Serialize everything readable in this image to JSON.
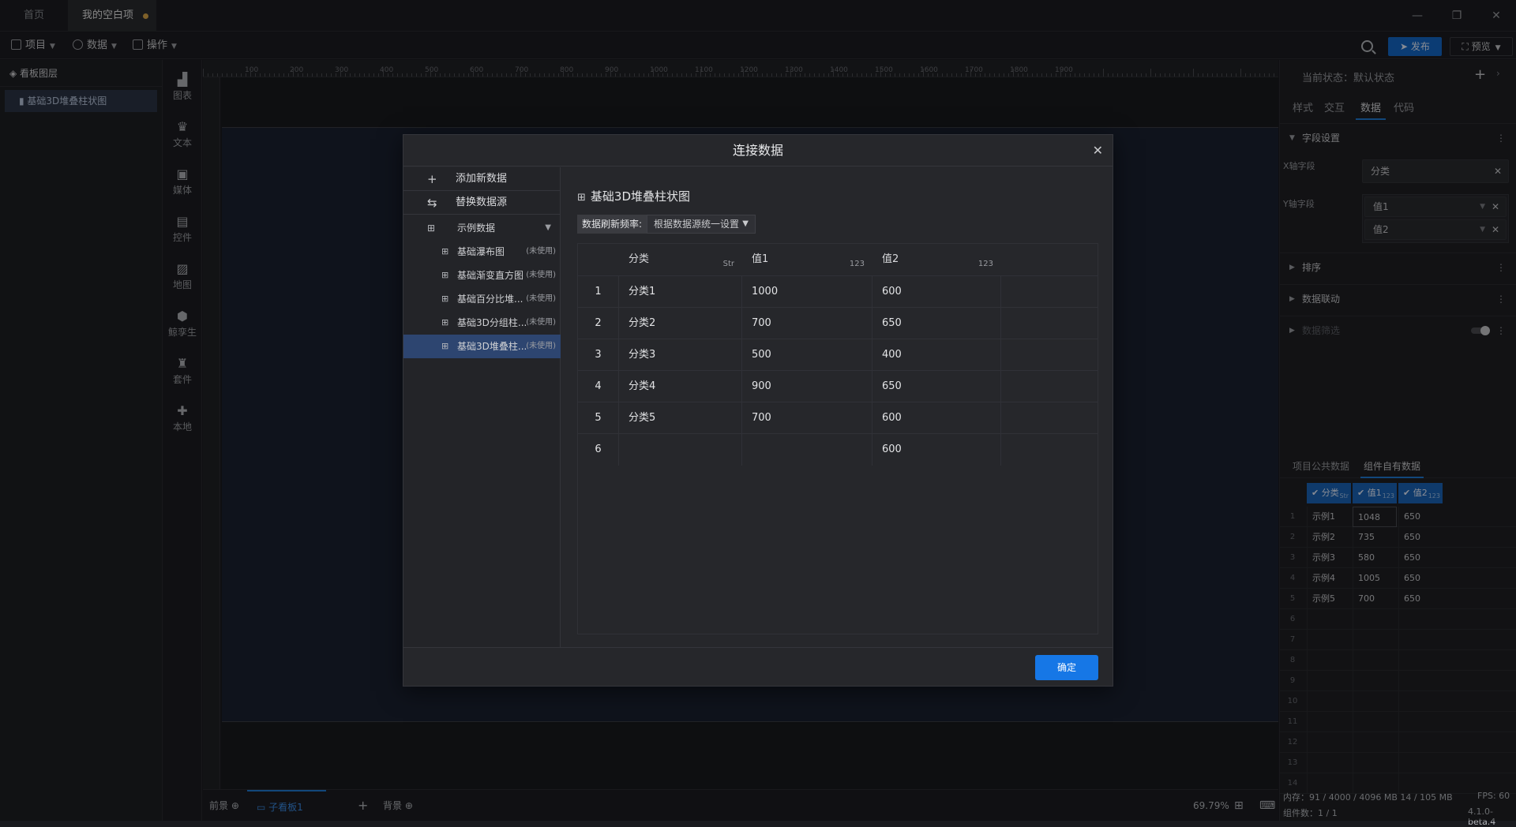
{
  "titlebar": {
    "tabs": [
      {
        "label": "首页"
      },
      {
        "label": "我的空白项目"
      }
    ]
  },
  "toolbar": {
    "menus": [
      {
        "label": "项目"
      },
      {
        "label": "数据"
      },
      {
        "label": "操作"
      }
    ],
    "publish": "发布",
    "preview": "预览"
  },
  "layers": {
    "header": "看板图层",
    "items": [
      {
        "label": "基础3D堆叠柱状图"
      }
    ]
  },
  "sidebar": {
    "items": [
      {
        "label": "图表",
        "icon": "chart-icon"
      },
      {
        "label": "文本",
        "icon": "text-icon"
      },
      {
        "label": "媒体",
        "icon": "media-icon"
      },
      {
        "label": "控件",
        "icon": "control-icon"
      },
      {
        "label": "地图",
        "icon": "map-icon"
      },
      {
        "label": "鲸孪生",
        "icon": "twin-icon"
      },
      {
        "label": "套件",
        "icon": "kit-icon"
      },
      {
        "label": "本地",
        "icon": "local-icon"
      }
    ]
  },
  "ruler": {
    "top": [
      "100",
      "200",
      "300",
      "400",
      "500",
      "600",
      "700",
      "800",
      "900",
      "1000",
      "1100",
      "1200",
      "1300",
      "1400",
      "1500",
      "1600",
      "1700",
      "1800",
      "1900"
    ]
  },
  "bottombar": {
    "front": "前景",
    "sub_board": "子看板1",
    "background": "背景",
    "zoom": "69.79%"
  },
  "rightpanel": {
    "state_label": "当前状态：",
    "state_value": "默认状态",
    "tabs": [
      {
        "label": "样式"
      },
      {
        "label": "交互"
      },
      {
        "label": "数据"
      },
      {
        "label": "代码"
      }
    ],
    "field_settings": "字段设置",
    "x_label": "X轴字段",
    "x_value": "分类",
    "y_label": "Y轴字段",
    "y_values": [
      "值1",
      "值2"
    ],
    "sort": "排序",
    "linkage": "数据联动",
    "filter": "数据筛选",
    "data_tabs": [
      {
        "label": "项目公共数据"
      },
      {
        "label": "组件自有数据"
      }
    ],
    "grid_headers": [
      {
        "label": "分类",
        "type": "Str"
      },
      {
        "label": "值1",
        "type": "123"
      },
      {
        "label": "值2",
        "type": "123"
      }
    ],
    "grid_rows": [
      [
        "示例1",
        "1048",
        "650"
      ],
      [
        "示例2",
        "735",
        "650"
      ],
      [
        "示例3",
        "580",
        "650"
      ],
      [
        "示例4",
        "1005",
        "650"
      ],
      [
        "示例5",
        "700",
        "650"
      ]
    ],
    "grid_row_numbers": [
      "1",
      "2",
      "3",
      "4",
      "5",
      "6",
      "7",
      "8",
      "9",
      "10",
      "11",
      "12",
      "13",
      "14"
    ],
    "memory": "内存：91 / 4000 / 4096 MB  14 / 105 MB",
    "fps": "FPS:  60",
    "components": "组件数：1 / 1",
    "version": "4.1.0-beta.4"
  },
  "modal": {
    "title": "连接数据",
    "add_data": "添加新数据",
    "replace_source": "替换数据源",
    "source_group": "示例数据",
    "datasets": [
      {
        "label": "基础瀑布图",
        "status": "(未使用)"
      },
      {
        "label": "基础渐变直方图",
        "status": "(未使用)"
      },
      {
        "label": "基础百分比堆...",
        "status": "(未使用)"
      },
      {
        "label": "基础3D分组柱...",
        "status": "(未使用)"
      },
      {
        "label": "基础3D堆叠柱...",
        "status": "(未使用)"
      }
    ],
    "dataset_title": "基础3D堆叠柱状图",
    "freq_label": "数据刷新频率:",
    "freq_value": "根据数据源统一设置",
    "columns": [
      {
        "label": "分类",
        "type": "Str"
      },
      {
        "label": "值1",
        "type": "123"
      },
      {
        "label": "值2",
        "type": "123"
      }
    ],
    "rows": [
      {
        "n": "1",
        "c": [
          "分类1",
          "1000",
          "600"
        ]
      },
      {
        "n": "2",
        "c": [
          "分类2",
          "700",
          "650"
        ]
      },
      {
        "n": "3",
        "c": [
          "分类3",
          "500",
          "400"
        ]
      },
      {
        "n": "4",
        "c": [
          "分类4",
          "900",
          "650"
        ]
      },
      {
        "n": "5",
        "c": [
          "分类5",
          "700",
          "600"
        ]
      },
      {
        "n": "6",
        "c": [
          "",
          "",
          "600"
        ]
      }
    ],
    "ok": "确定"
  }
}
